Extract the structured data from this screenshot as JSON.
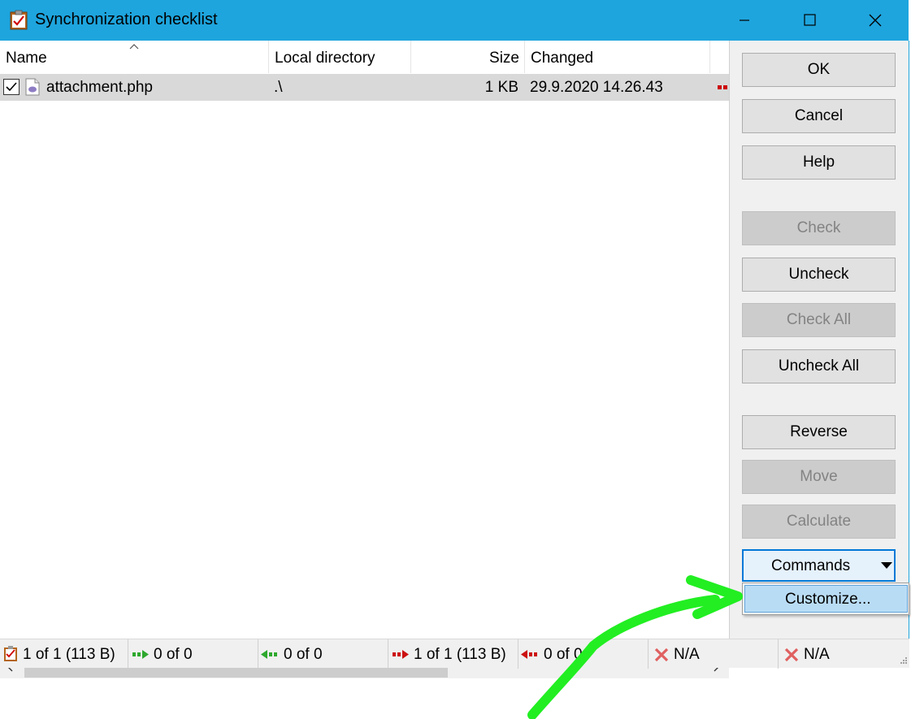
{
  "window": {
    "title": "Synchronization checklist"
  },
  "list": {
    "columns": [
      {
        "label": "Name"
      },
      {
        "label": "Local directory"
      },
      {
        "label": "Size"
      },
      {
        "label": "Changed"
      }
    ],
    "rows": [
      {
        "checked": true,
        "name": "attachment.php",
        "local_directory": ".\\",
        "size": "1 KB",
        "changed": "29.9.2020 14.26.43",
        "action_icon": "upload-red-arrow-icon"
      }
    ]
  },
  "buttons": {
    "ok": "OK",
    "cancel": "Cancel",
    "help": "Help",
    "check": "Check",
    "uncheck": "Uncheck",
    "check_all": "Check All",
    "uncheck_all": "Uncheck All",
    "reverse": "Reverse",
    "move": "Move",
    "calculate": "Calculate",
    "commands": "Commands"
  },
  "popup_menu": {
    "items": [
      "Customize..."
    ]
  },
  "statusbar": {
    "checklist": "1 of 1 (113 B)",
    "upload_new": "0 of 0",
    "download_new": "0 of 0",
    "upload_update": "1 of 1 (113 B)",
    "download_update": "0 of 0",
    "delete_remote": "N/A",
    "delete_local": "N/A"
  },
  "colors": {
    "titlebar": "#1ea5de",
    "accent": "#0078d7",
    "annotation": "#22ee22"
  }
}
